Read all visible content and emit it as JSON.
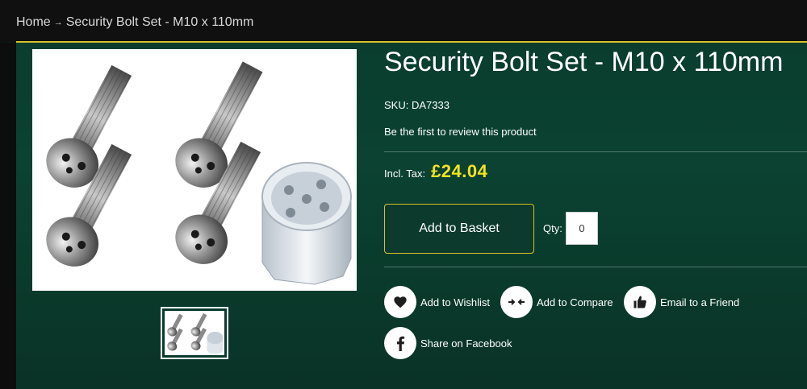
{
  "breadcrumb": {
    "home": "Home",
    "separator": "→",
    "current": "Security Bolt Set - M10 x 110mm"
  },
  "product": {
    "title": "Security Bolt Set - M10 x 110mm",
    "sku": "SKU: DA7333",
    "review_link": "Be the first to review this product",
    "price_label": "Incl. Tax:",
    "price": "£24.04",
    "basket_button": "Add to Basket",
    "qty_label": "Qty:",
    "qty_value": "0"
  },
  "actions": {
    "wishlist": {
      "label": "Add to Wishlist",
      "icon": "heart-icon"
    },
    "compare": {
      "label": "Add to Compare",
      "icon": "compare-arrows-icon"
    },
    "email": {
      "label": "Email to a Friend",
      "icon": "thumbs-up-icon"
    },
    "facebook": {
      "label": "Share on Facebook",
      "icon": "facebook-icon"
    }
  },
  "colors": {
    "accent_gold": "#d8c22a",
    "price_yellow": "#f2e320",
    "panel_green": "#0b4232"
  }
}
